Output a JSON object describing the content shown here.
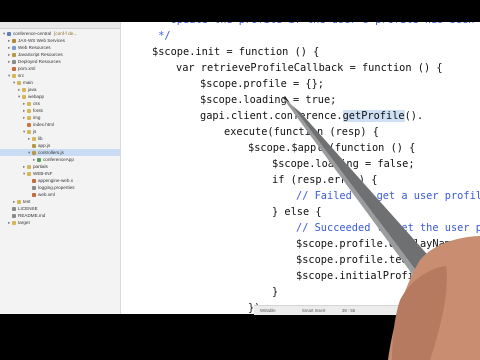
{
  "project_tree": {
    "items": [
      {
        "label": "conference-central",
        "depth": 0,
        "twisty": "▾",
        "icon_color": "#5a7ec2",
        "annotation": "[conf-f de..."
      },
      {
        "label": "JAX-WS Web Services",
        "depth": 1,
        "twisty": "▸",
        "icon_color": "#b0883a",
        "annotation": ""
      },
      {
        "label": "Web Resources",
        "depth": 1,
        "twisty": "▸",
        "icon_color": "#7a9ed2",
        "annotation": ""
      },
      {
        "label": "JavaScript Resources",
        "depth": 1,
        "twisty": "▸",
        "icon_color": "#b49a44",
        "annotation": ""
      },
      {
        "label": "Deployed Resources",
        "depth": 1,
        "twisty": "▸",
        "icon_color": "#8a8a8a",
        "annotation": ""
      },
      {
        "label": "pom.xml",
        "depth": 1,
        "twisty": "",
        "icon_color": "#c96a3a",
        "annotation": ""
      },
      {
        "label": "src",
        "depth": 1,
        "twisty": "▾",
        "icon_color": "#d6b656",
        "annotation": ""
      },
      {
        "label": "main",
        "depth": 2,
        "twisty": "▾",
        "icon_color": "#d6b656",
        "annotation": ""
      },
      {
        "label": "java",
        "depth": 3,
        "twisty": "▸",
        "icon_color": "#d6b656",
        "annotation": ""
      },
      {
        "label": "webapp",
        "depth": 3,
        "twisty": "▾",
        "icon_color": "#d6b656",
        "annotation": ""
      },
      {
        "label": "css",
        "depth": 4,
        "twisty": "▸",
        "icon_color": "#d6b656",
        "annotation": ""
      },
      {
        "label": "fonts",
        "depth": 4,
        "twisty": "▸",
        "icon_color": "#d6b656",
        "annotation": ""
      },
      {
        "label": "img",
        "depth": 4,
        "twisty": "▸",
        "icon_color": "#d6b656",
        "annotation": ""
      },
      {
        "label": "index.html",
        "depth": 4,
        "twisty": "",
        "icon_color": "#d2733a",
        "annotation": ""
      },
      {
        "label": "js",
        "depth": 4,
        "twisty": "▾",
        "icon_color": "#d6b656",
        "annotation": ""
      },
      {
        "label": "lib",
        "depth": 5,
        "twisty": "▸",
        "icon_color": "#d6b656",
        "annotation": ""
      },
      {
        "label": "app.js",
        "depth": 5,
        "twisty": "",
        "icon_color": "#b49a44",
        "annotation": ""
      },
      {
        "label": "controllers.js",
        "depth": 5,
        "twisty": "▾",
        "icon_color": "#b49a44",
        "annotation": "",
        "selected": true
      },
      {
        "label": "conferenceApp",
        "depth": 6,
        "twisty": "▸",
        "icon_color": "#5aa05a",
        "annotation": ""
      },
      {
        "label": "partials",
        "depth": 4,
        "twisty": "▸",
        "icon_color": "#d6b656",
        "annotation": ""
      },
      {
        "label": "WEB-INF",
        "depth": 4,
        "twisty": "▾",
        "icon_color": "#d6b656",
        "annotation": ""
      },
      {
        "label": "appengine-web.x",
        "depth": 5,
        "twisty": "",
        "icon_color": "#c96a3a",
        "annotation": ""
      },
      {
        "label": "logging.properties",
        "depth": 5,
        "twisty": "",
        "icon_color": "#8a8a8a",
        "annotation": ""
      },
      {
        "label": "web.xml",
        "depth": 5,
        "twisty": "",
        "icon_color": "#c96a3a",
        "annotation": ""
      },
      {
        "label": "test",
        "depth": 2,
        "twisty": "▸",
        "icon_color": "#d6b656",
        "annotation": ""
      },
      {
        "label": "LICENSE",
        "depth": 1,
        "twisty": "",
        "icon_color": "#8a8a8a",
        "annotation": ""
      },
      {
        "label": "README.md",
        "depth": 1,
        "twisty": "",
        "icon_color": "#8a8a8a",
        "annotation": ""
      },
      {
        "label": "target",
        "depth": 1,
        "twisty": "▸",
        "icon_color": "#d6b656",
        "annotation": ""
      }
    ]
  },
  "editor": {
    "lines": [
      {
        "indent": 0,
        "parts": [
          {
            "t": "/**",
            "cls": "cm"
          }
        ]
      },
      {
        "indent": 0,
        "parts": [
          {
            "t": " * Update the profile if the user's profile has been stored.",
            "cls": "cm"
          }
        ]
      },
      {
        "indent": 0,
        "parts": [
          {
            "t": " */",
            "cls": "cm"
          }
        ]
      },
      {
        "indent": 0,
        "parts": [
          {
            "t": "$scope.init = function () {",
            "cls": ""
          }
        ]
      },
      {
        "indent": 1,
        "parts": [
          {
            "t": "var retrieveProfileCallback = function () {",
            "cls": ""
          }
        ]
      },
      {
        "indent": 2,
        "parts": [
          {
            "t": "$scope.profile = {};",
            "cls": ""
          }
        ]
      },
      {
        "indent": 2,
        "parts": [
          {
            "t": "$scope.loading = true;",
            "cls": ""
          }
        ]
      },
      {
        "indent": 2,
        "parts": [
          {
            "t": "gapi.client.conference.",
            "cls": ""
          },
          {
            "t": "getProfile",
            "cls": "hl"
          },
          {
            "t": "().",
            "cls": ""
          }
        ]
      },
      {
        "indent": 3,
        "parts": [
          {
            "t": "execute(function (resp) {",
            "cls": ""
          }
        ]
      },
      {
        "indent": 4,
        "parts": [
          {
            "t": "$scope.$apply(function () {",
            "cls": ""
          }
        ]
      },
      {
        "indent": 5,
        "parts": [
          {
            "t": "$scope.loading = false;",
            "cls": ""
          }
        ]
      },
      {
        "indent": 5,
        "parts": [
          {
            "t": "if (resp.error) {",
            "cls": ""
          }
        ]
      },
      {
        "indent": 6,
        "parts": [
          {
            "t": "// Failed to get a user profile.",
            "cls": "cm"
          }
        ]
      },
      {
        "indent": 5,
        "parts": [
          {
            "t": "} else {",
            "cls": ""
          }
        ]
      },
      {
        "indent": 6,
        "parts": [
          {
            "t": "// Succeeded to get the user profile.",
            "cls": "cm"
          }
        ]
      },
      {
        "indent": 6,
        "parts": [
          {
            "t": "$scope.profile.displayName = resp.result.displayName;",
            "cls": ""
          }
        ]
      },
      {
        "indent": 6,
        "parts": [
          {
            "t": "$scope.profile.teeShirtSize = resp.result.teeShirtSize;",
            "cls": ""
          }
        ]
      },
      {
        "indent": 6,
        "parts": [
          {
            "t": "$scope.initialProfile = resp.result;",
            "cls": ""
          }
        ]
      },
      {
        "indent": 5,
        "parts": [
          {
            "t": "}",
            "cls": ""
          }
        ]
      },
      {
        "indent": 4,
        "parts": [
          {
            "t": "});",
            "cls": ""
          }
        ]
      },
      {
        "indent": 3,
        "parts": [
          {
            "t": "}",
            "cls": ""
          }
        ]
      },
      {
        "indent": 2,
        "parts": [
          {
            "t": ");",
            "cls": ""
          }
        ]
      }
    ]
  },
  "status_bar": {
    "mode": "Writable",
    "insert": "Smart Insert",
    "position": "39 : 55"
  },
  "colors": {
    "comment": "#3b5bd7",
    "selection": "#cfe0f5",
    "letterbox": "#000000"
  }
}
